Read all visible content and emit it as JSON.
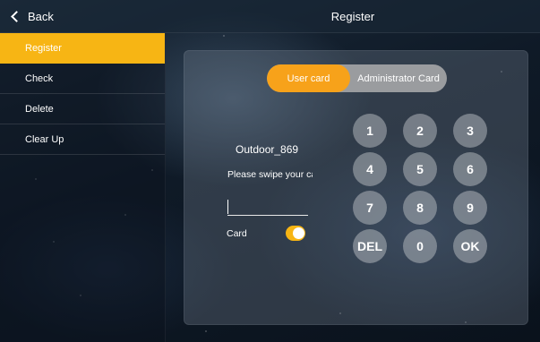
{
  "header": {
    "back_label": "Back",
    "title": "Register"
  },
  "sidebar": {
    "items": [
      {
        "label": "Register",
        "active": true
      },
      {
        "label": "Check",
        "active": false
      },
      {
        "label": "Delete",
        "active": false
      },
      {
        "label": "Clear Up",
        "active": false
      }
    ]
  },
  "tabs": [
    {
      "label": "User card",
      "active": true
    },
    {
      "label": "Administrator Card",
      "active": false
    }
  ],
  "form": {
    "device_name": "Outdoor_869",
    "prompt": "Please swipe your card",
    "input_value": "",
    "card_toggle_label": "Card",
    "card_toggle_on": true
  },
  "keypad": {
    "keys": [
      "1",
      "2",
      "3",
      "4",
      "5",
      "6",
      "7",
      "8",
      "9",
      "DEL",
      "0",
      "OK"
    ]
  },
  "colors": {
    "accent": "#f7b514",
    "tab_active": "#f7a21a",
    "tab_inactive": "#9a9c9f"
  }
}
